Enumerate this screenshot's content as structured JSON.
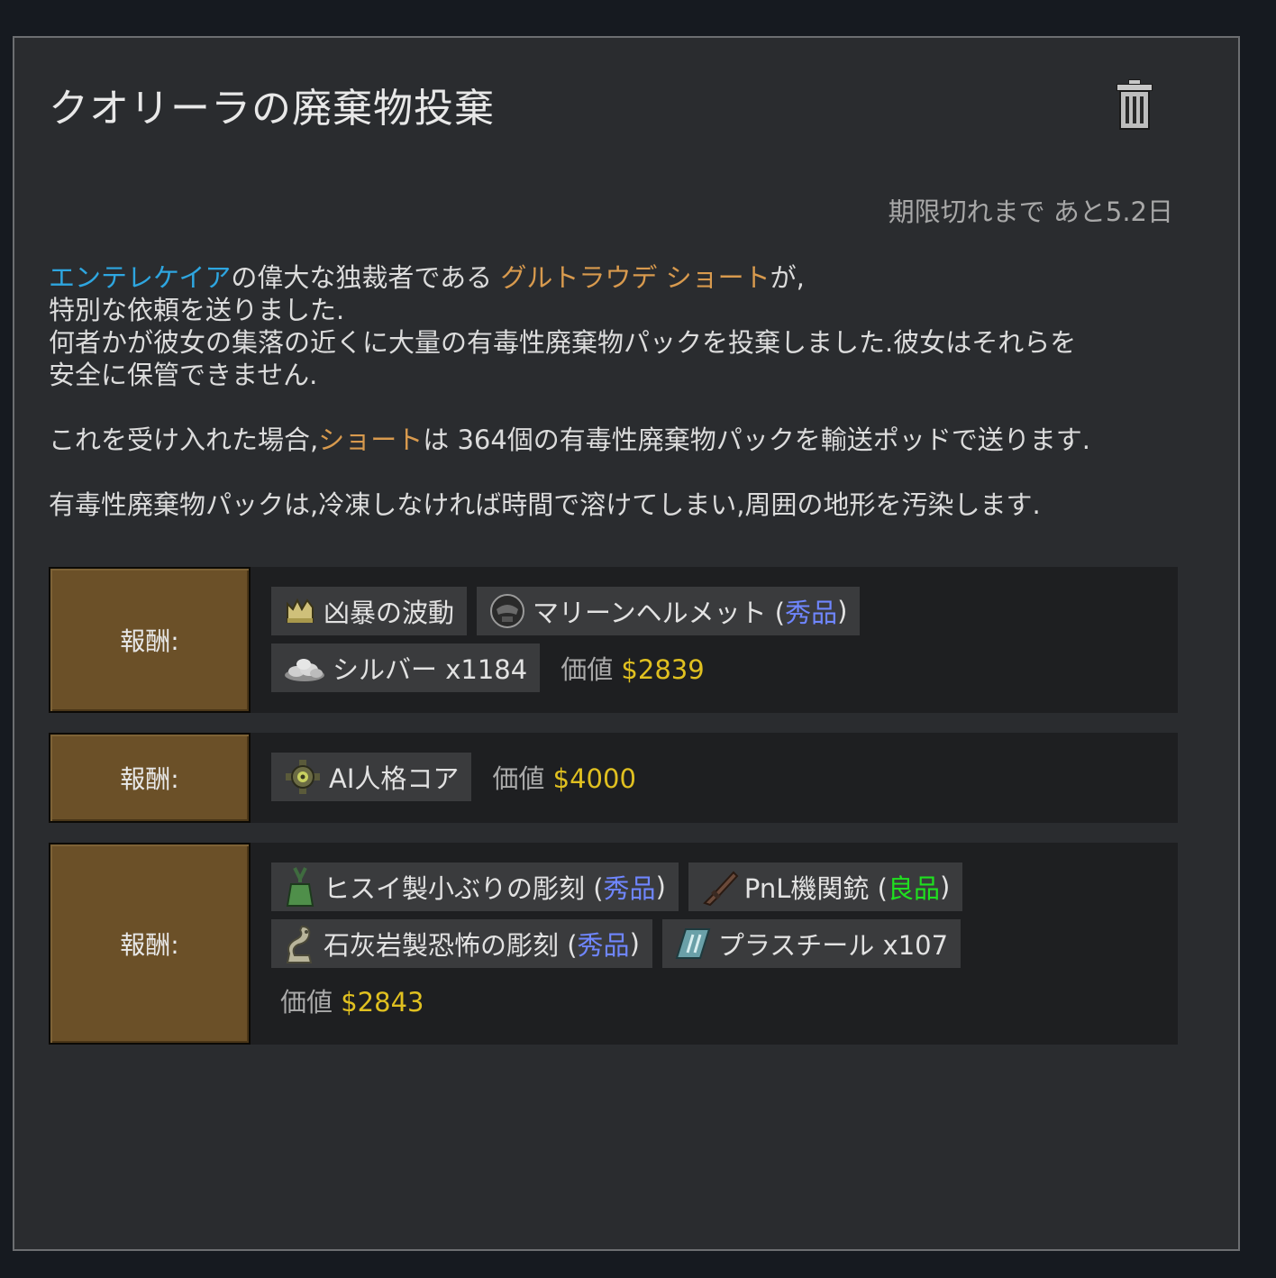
{
  "quest": {
    "title": "クオリーラの廃棄物投棄",
    "expiry": "期限切れまで あと5.2日"
  },
  "description": {
    "line1": {
      "faction": "エンテレケイア",
      "part1": "の偉大な独裁者である ",
      "leader": "グルトラウデ ショート",
      "part2": "が,"
    },
    "line2": "特別な依頼を送りました.",
    "line3": "何者かが彼女の集落の近くに大量の有毒性廃棄物パックを投棄しました.彼女はそれらを",
    "line4": "安全に保管できません.",
    "line5": {
      "part1": "これを受け入れた場合,",
      "name": "ショート",
      "part2": "は 364個の有毒性廃棄物パックを輸送ポッドで送ります."
    },
    "line6": "有毒性廃棄物パックは,冷凍しなければ時間で溶けてしまい,周囲の地形を汚染します."
  },
  "rewards": [
    {
      "label": "報酬:",
      "items": [
        {
          "name": "凶暴の波動",
          "icon": "psychic-crown-icon"
        },
        {
          "name": "マリーンヘルメット (",
          "quality": "秀品",
          "close": ")",
          "icon": "helmet-icon"
        },
        {
          "name": "シルバー x1184",
          "icon": "silver-pile-icon"
        }
      ],
      "value_label": "価値",
      "value": "$2839"
    },
    {
      "label": "報酬:",
      "items": [
        {
          "name": "AI人格コア",
          "icon": "ai-core-icon"
        }
      ],
      "value_label": "価値",
      "value": "$4000"
    },
    {
      "label": "報酬:",
      "items": [
        {
          "name": "ヒスイ製小ぶりの彫刻 (",
          "quality": "秀品",
          "close": ")",
          "icon": "jade-sculpture-icon"
        },
        {
          "name": "PnL機関銃 (",
          "quality": "良品",
          "close": ")",
          "icon": "machine-gun-icon"
        },
        {
          "name": "石灰岩製恐怖の彫刻 (",
          "quality": "秀品",
          "close": ")",
          "icon": "stone-sculpture-icon"
        },
        {
          "name": "プラスチール x107",
          "icon": "plasteel-icon"
        }
      ],
      "value_label": "価値",
      "value": "$2843"
    }
  ],
  "colors": {
    "faction": "#2ea6e0",
    "person": "#d89a4e",
    "excellent": "#6f86ff",
    "good": "#1fe01f",
    "value": "#e0c020",
    "reward_button": "#6b5028"
  }
}
